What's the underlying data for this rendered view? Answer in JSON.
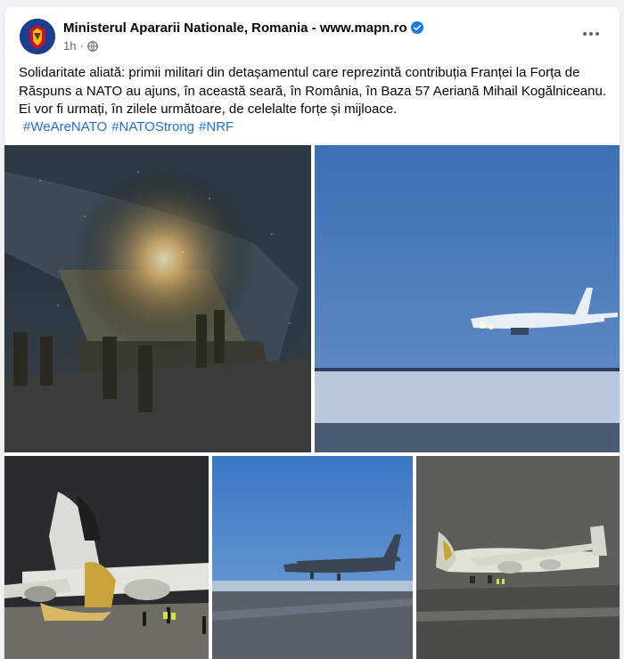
{
  "post": {
    "author": "Ministerul Apararii Nationale, Romania - www.mapn.ro",
    "time": "1h",
    "text_line1": "Solidaritate aliată: primii militari din detașamentul care reprezintă contribuția Franței la Forța de",
    "text_line2": "Răspuns a NATO au ajuns, în această seară, în România, în Baza 57 Aeriană Mihail Kogălniceanu.",
    "text_line3": "Ei vor fi urmați, în zilele următoare, de celelalte forțe și mijloace.",
    "hashtags": [
      "#WeAreNATO",
      "#NATOStrong",
      "#NRF"
    ]
  },
  "photos": [
    {
      "name": "troops-boarding-aircraft-photo",
      "description": "Soldiers walking from cargo aircraft at night"
    },
    {
      "name": "aircraft-landing-photo",
      "description": "Large cargo aircraft landing over snowy airfield"
    },
    {
      "name": "open-nose-aircraft-photo",
      "description": "Cargo aircraft with raised nose unloading at night"
    },
    {
      "name": "c130-landing-photo",
      "description": "Turboprop military transport landing"
    },
    {
      "name": "parked-cargo-aircraft-photo",
      "description": "Large cargo aircraft parked on apron in fog"
    }
  ],
  "colors": {
    "link": "#216fdb",
    "verified": "#1877f2",
    "secondary": "#65676b"
  },
  "icons": {
    "verified": "verified-badge-icon",
    "privacy": "globe-icon",
    "more": "more-options-icon"
  }
}
